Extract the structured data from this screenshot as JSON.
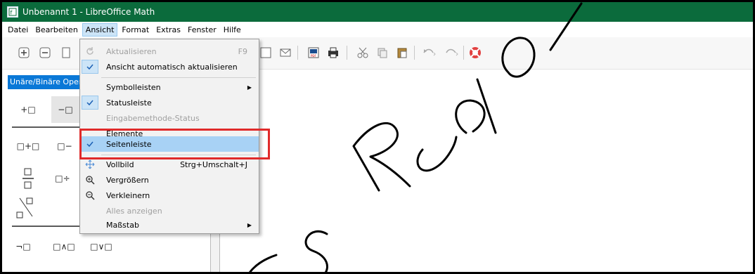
{
  "window": {
    "title": "Unbenannt 1 - LibreOffice Math",
    "accent_color": "#0b6b3c"
  },
  "menubar": [
    {
      "label": "Datei"
    },
    {
      "label": "Bearbeiten"
    },
    {
      "label": "Ansicht"
    },
    {
      "label": "Format"
    },
    {
      "label": "Extras"
    },
    {
      "label": "Fenster"
    },
    {
      "label": "Hilfe"
    }
  ],
  "sidebar": {
    "category": "Unäre/Binäre Opera",
    "rows": [
      [
        "+□",
        "−□"
      ],
      [
        "□+□",
        "□−"
      ],
      [
        "□÷"
      ],
      [
        "¬□",
        "□∧□",
        "□∨□"
      ]
    ]
  },
  "view_menu": {
    "items": [
      {
        "label": "Aktualisieren",
        "shortcut": "F9",
        "icon": "refresh-icon",
        "disabled": true
      },
      {
        "label": "Ansicht automatisch aktualisieren",
        "checked": true
      },
      {
        "label": "Symbolleisten",
        "submenu": true
      },
      {
        "label": "Statusleiste",
        "checked": true
      },
      {
        "label": "Eingabemethode-Status",
        "disabled": true
      },
      {
        "label": "Elemente"
      },
      {
        "label": "Seitenleiste",
        "checked": true,
        "highlighted": true
      },
      {
        "label": "Vollbild",
        "shortcut": "Strg+Umschalt+J",
        "icon": "fullscreen-icon"
      },
      {
        "label": "Vergrößern",
        "icon": "zoom-in-icon"
      },
      {
        "label": "Verkleinern",
        "icon": "zoom-out-icon"
      },
      {
        "label": "Alles anzeigen",
        "disabled": true
      },
      {
        "label": "Maßstab",
        "submenu": true
      }
    ]
  },
  "annotation": {
    "color": "#e02a2a"
  },
  "watermark": {
    "text": "Rudo"
  }
}
